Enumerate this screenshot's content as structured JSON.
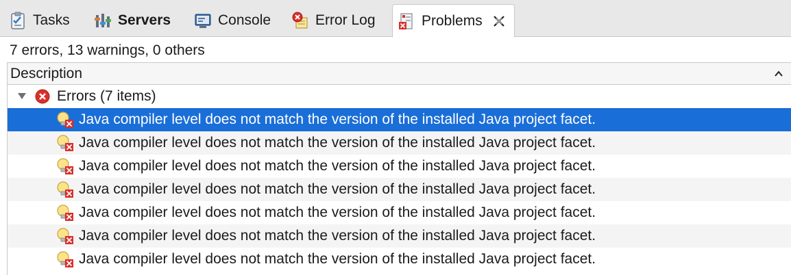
{
  "tabs": [
    {
      "label": "Tasks",
      "icon": "tasks-icon",
      "active": false,
      "bold": false
    },
    {
      "label": "Servers",
      "icon": "servers-icon",
      "active": false,
      "bold": true
    },
    {
      "label": "Console",
      "icon": "console-icon",
      "active": false,
      "bold": false
    },
    {
      "label": "Error Log",
      "icon": "error-log-icon",
      "active": false,
      "bold": false
    },
    {
      "label": "Problems",
      "icon": "problems-icon",
      "active": true,
      "bold": false
    }
  ],
  "summary": "7 errors, 13 warnings, 0 others",
  "table": {
    "column_header": "Description",
    "sort_icon": "chevron-up-icon",
    "group": {
      "label": "Errors (7 items)",
      "icon": "error-circle-icon",
      "expanded": true
    },
    "rows": [
      {
        "description": "Java compiler level does not match the version of the installed Java project facet.",
        "selected": true
      },
      {
        "description": "Java compiler level does not match the version of the installed Java project facet.",
        "selected": false
      },
      {
        "description": "Java compiler level does not match the version of the installed Java project facet.",
        "selected": false
      },
      {
        "description": "Java compiler level does not match the version of the installed Java project facet.",
        "selected": false
      },
      {
        "description": "Java compiler level does not match the version of the installed Java project facet.",
        "selected": false
      },
      {
        "description": "Java compiler level does not match the version of the installed Java project facet.",
        "selected": false
      },
      {
        "description": "Java compiler level does not match the version of the installed Java project facet.",
        "selected": false
      }
    ]
  },
  "colors": {
    "selection": "#1a6ed8",
    "error_red": "#d9302c",
    "alt_row": "#f4f4f4",
    "tabbar_bg": "#e8e8e8"
  }
}
